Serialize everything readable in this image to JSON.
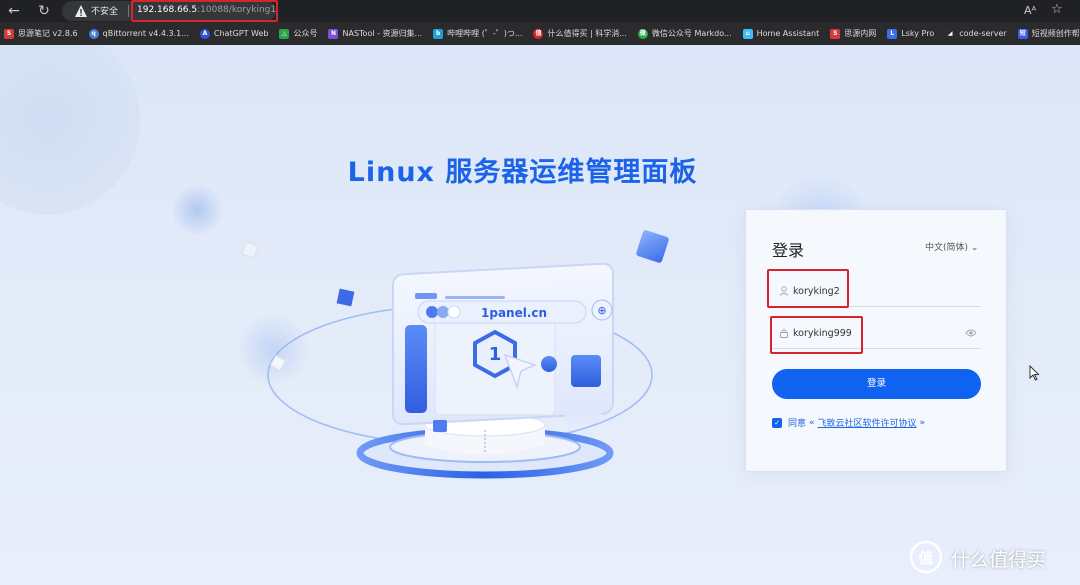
{
  "browser": {
    "security_label": "不安全",
    "url_host": "192.168.66.5",
    "url_path": ":10088/koryking1",
    "reader_label": "Aᴬ",
    "bookmarks": [
      {
        "label": "思源笔记 v2.8.6",
        "icon_color": "#d23b3b",
        "icon_char": "S"
      },
      {
        "label": "qBittorrent v4.4.3.1...",
        "icon_color": "#3f7fd8",
        "icon_char": "q"
      },
      {
        "label": "ChatGPT Web",
        "icon_color": "#3154d6",
        "icon_char": "A"
      },
      {
        "label": "公众号",
        "icon_color": "#2aa14a",
        "icon_char": "△"
      },
      {
        "label": "NASTool - 资源归集...",
        "icon_color": "#7c4fd6",
        "icon_char": "N"
      },
      {
        "label": "哔哩哔哩 (゜-゜)つ...",
        "icon_color": "#1e9fd9",
        "icon_char": "b"
      },
      {
        "label": "什么值得买 | 科学消...",
        "icon_color": "#d7262b",
        "icon_char": "值"
      },
      {
        "label": "微信公众号 Markdo...",
        "icon_color": "#2aae4a",
        "icon_char": "微"
      },
      {
        "label": "Home Assistant",
        "icon_color": "#41bdf5",
        "icon_char": "⌂"
      },
      {
        "label": "思源内网",
        "icon_color": "#d23b3b",
        "icon_char": "S"
      },
      {
        "label": "Lsky Pro",
        "icon_color": "#3b6ee8",
        "icon_char": "L"
      },
      {
        "label": "code-server",
        "icon_color": "#2c2c2c",
        "icon_char": "◢"
      },
      {
        "label": "短视频创作帮手模...",
        "icon_color": "#3b5de8",
        "icon_char": "短"
      }
    ]
  },
  "page": {
    "title": "Linux 服务器运维管理面板",
    "illustration_label": "1panel.cn"
  },
  "login": {
    "title": "登录",
    "language": "中文(简体)",
    "username": "koryking2",
    "password": "koryking999",
    "submit_label": "登录",
    "agree_prefix": "同意",
    "agree_link": "飞致云社区软件许可协议",
    "agree_open_quote": "«",
    "agree_close_quote": "»"
  },
  "watermark": {
    "text": "什么值得买",
    "logo_char": "值"
  },
  "colors": {
    "brand_blue": "#1b63e8",
    "button_blue": "#1063f0",
    "annotation_red": "#d6242a",
    "chrome_dark": "#202124"
  }
}
